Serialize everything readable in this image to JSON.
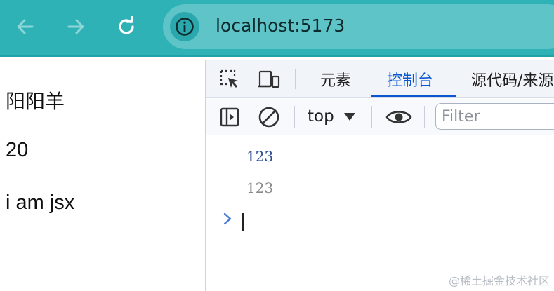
{
  "browser": {
    "url": "localhost:5173",
    "icons": {
      "back": "arrow-left-icon",
      "forward": "arrow-right-icon",
      "reload": "reload-icon",
      "site_info": "info-icon"
    },
    "theme_color": "#2fb2b6"
  },
  "page": {
    "lines": [
      "阳阳羊",
      "20",
      "i am jsx"
    ]
  },
  "devtools": {
    "tabs": [
      "元素",
      "控制台",
      "源代码/来源"
    ],
    "active_tab": "控制台",
    "toolbar": {
      "context": "top",
      "filter_placeholder": "Filter"
    },
    "console": {
      "logs": [
        "123",
        "123"
      ]
    },
    "accent_color": "#0b57d0"
  },
  "watermark": "@稀土掘金技术社区"
}
